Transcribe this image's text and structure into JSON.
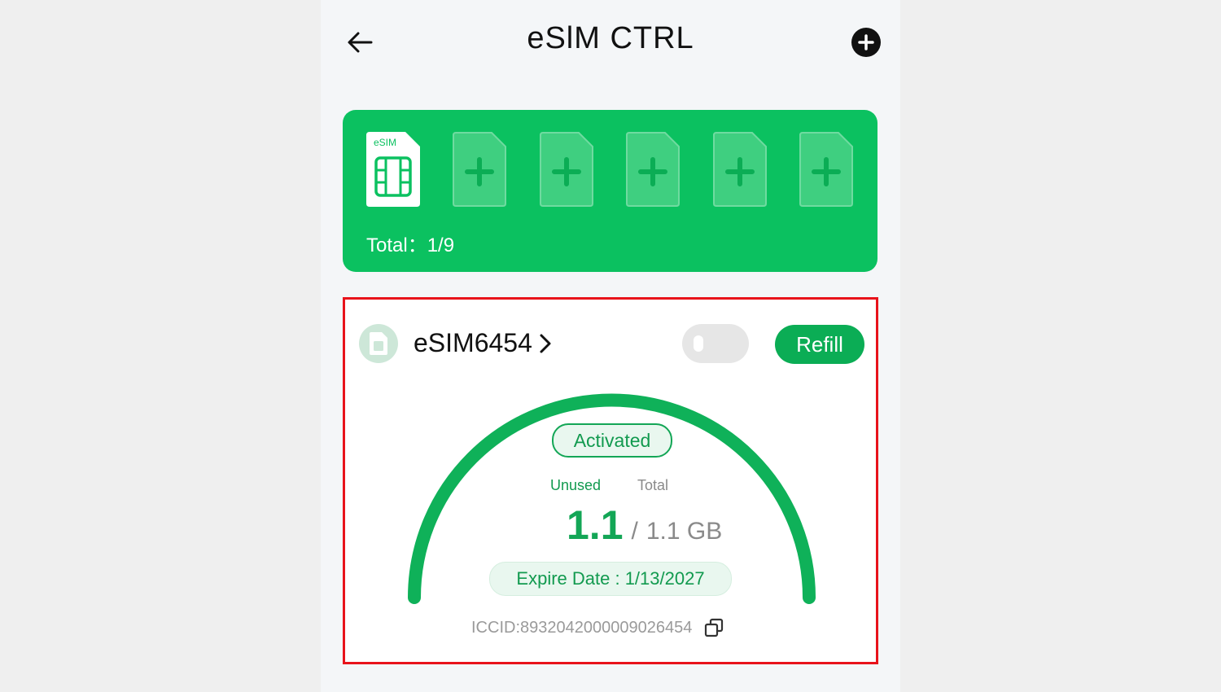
{
  "header": {
    "title": "eSlM CTRL",
    "back_icon": "arrow-left-icon",
    "add_icon": "plus-circle-icon"
  },
  "sim_slots": {
    "active_label": "eSIM",
    "empty_slot_icon": "plus-icon",
    "total_label": "Total：1/9"
  },
  "esim": {
    "name": "eSIM6454",
    "toggle_on": false,
    "refill_label": "Refill",
    "status": "Activated",
    "unused_label": "Unused",
    "total_label": "Total",
    "unused_value": "1.1",
    "slash": "/",
    "total_value": "1.1 GB",
    "expire_text": "Expire Date : 1/13/2027",
    "iccid": "ICCID:89320420000090264​54",
    "usage_fraction": 1.0
  },
  "colors": {
    "brand_green": "#0bc160",
    "accent_green": "#13a656",
    "highlight_border": "#e8131b"
  }
}
